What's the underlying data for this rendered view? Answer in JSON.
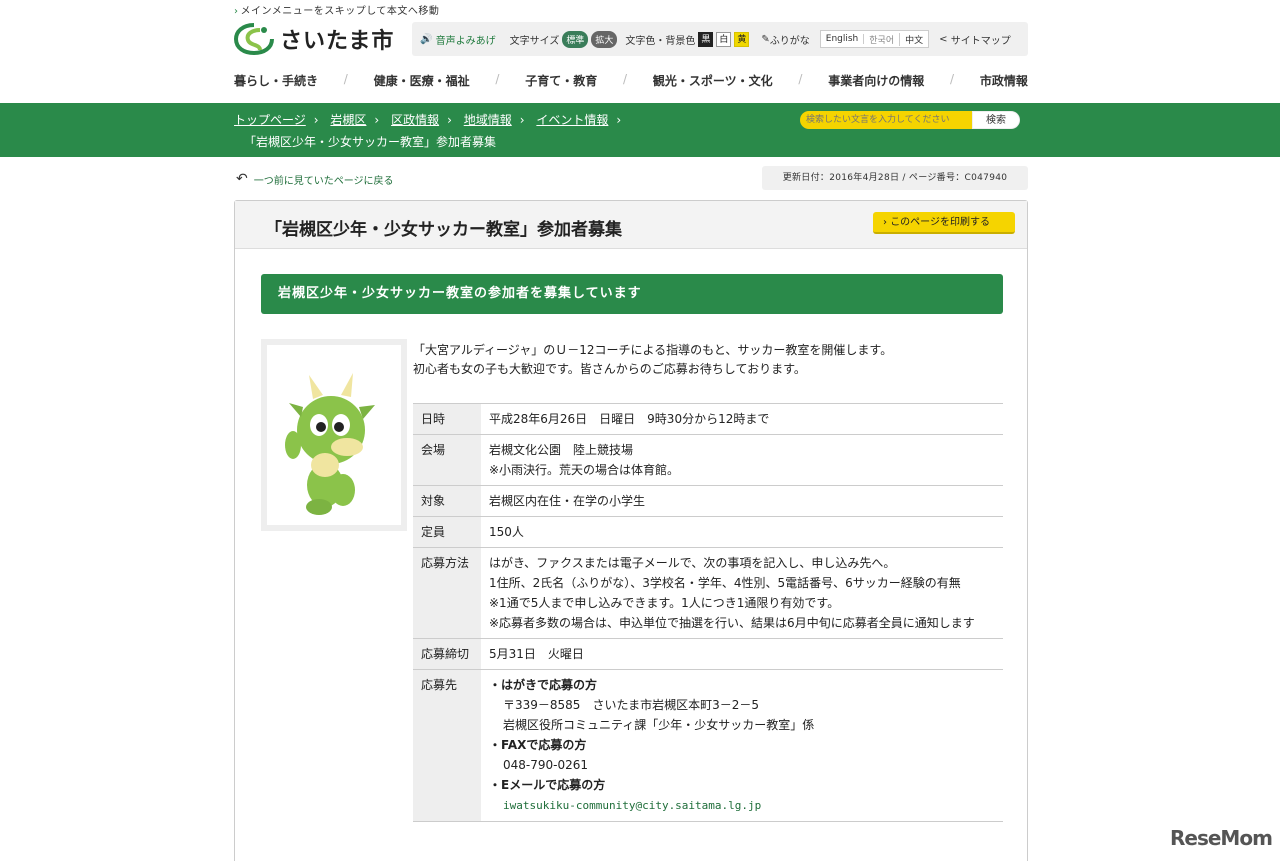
{
  "skip": {
    "text": "メインメニューをスキップして本文へ移動"
  },
  "logo": {
    "text": "さいたま市"
  },
  "util": {
    "voice": "音声よみあげ",
    "font_size_label": "文字サイズ",
    "font_std": "標準",
    "font_big": "拡大",
    "color_label": "文字色・背景色",
    "color_black": "黒",
    "color_white": "白",
    "color_yellow": "黄",
    "furigana": "ふりがな",
    "lang_en": "English",
    "lang_ko": "한국어",
    "lang_zh": "中文",
    "sitemap": "サイトマップ"
  },
  "gnav": [
    "暮らし・手続き",
    "健康・医療・福祉",
    "子育て・教育",
    "観光・スポーツ・文化",
    "事業者向けの情報",
    "市政情報"
  ],
  "breadcrumbs": [
    "トップページ",
    "岩槻区",
    "区政情報",
    "地域情報",
    "イベント情報"
  ],
  "breadcrumb_current": "「岩槻区少年・少女サッカー教室」参加者募集",
  "search": {
    "placeholder": "検索したい文言を入力してください",
    "button": "検索"
  },
  "back_link": "一つ前に見ていたページに戻る",
  "meta": "更新日付：2016年4月28日 / ページ番号：C047940",
  "page_title": "「岩槻区少年・少女サッカー教室」参加者募集",
  "print_button": "このページを印刷する",
  "section_heading": "岩槻区少年・少女サッカー教室の参加者を募集しています",
  "intro": [
    "「大宮アルディージャ」のＵ－12コーチによる指導のもと、サッカー教室を開催します。",
    "初心者も女の子も大歓迎です。皆さんからのご応募お待ちしております。"
  ],
  "info_table": {
    "date_h": "日時",
    "date_v": "平成28年6月26日　日曜日　9時30分から12時まで",
    "venue_h": "会場",
    "venue_v1": "岩槻文化公園　陸上競技場",
    "venue_v2": "※小雨決行。荒天の場合は体育館。",
    "target_h": "対象",
    "target_v": "岩槻区内在住・在学の小学生",
    "capacity_h": "定員",
    "capacity_v": "150人",
    "apply_h": "応募方法",
    "apply_v1": "はがき、ファクスまたは電子メールで、次の事項を記入し、申し込み先へ。",
    "apply_v2": "1住所、2氏名（ふりがな）、3学校名・学年、4性別、5電話番号、6サッカー経験の有無",
    "apply_v3": "※1通で5人まで申し込みできます。1人につき1通限り有効です。",
    "apply_v4": "※応募者多数の場合は、申込単位で抽選を行い、結果は6月中旬に応募者全員に通知します",
    "deadline_h": "応募締切",
    "deadline_v": "5月31日　火曜日",
    "dest_h": "応募先",
    "dest_post_h": "・はがきで応募の方",
    "dest_post_1": "〒339－8585　さいたま市岩槻区本町3－2－5",
    "dest_post_2": "岩槻区役所コミュニティ課「少年・少女サッカー教室」係",
    "dest_fax_h": "・FAXで応募の方",
    "dest_fax_v": "048-790-0261",
    "dest_mail_h": "・Eメールで応募の方",
    "dest_mail_v": "iwatsukiku-community@city.saitama.lg.jp"
  },
  "brand": "ReseMom",
  "colors": {
    "green": "#2a8a4a",
    "yellow": "#f5d400"
  }
}
